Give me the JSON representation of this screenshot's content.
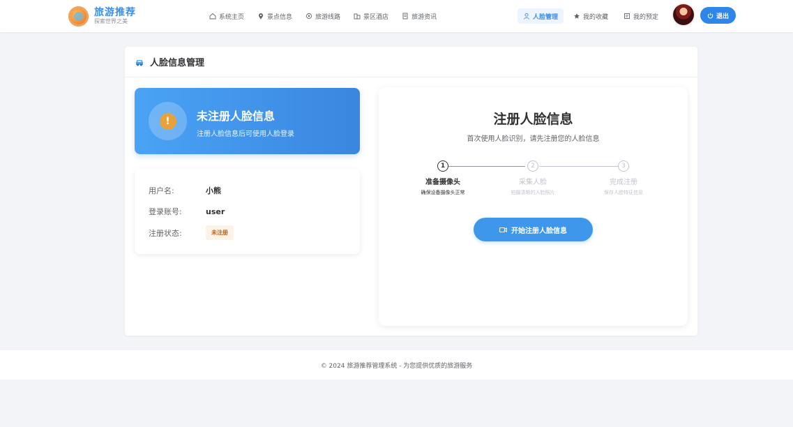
{
  "header": {
    "logo_title": "旅游推荐",
    "logo_subtitle": "探索世界之美",
    "nav": [
      {
        "label": "系统主页",
        "icon": "home-icon"
      },
      {
        "label": "景点信息",
        "icon": "location-pin-icon"
      },
      {
        "label": "旅游线路",
        "icon": "route-icon"
      },
      {
        "label": "景区酒店",
        "icon": "hotel-icon"
      },
      {
        "label": "旅游资讯",
        "icon": "document-icon"
      }
    ],
    "right_nav": [
      {
        "label": "人脸管理",
        "icon": "user-icon",
        "active": true
      },
      {
        "label": "我的收藏",
        "icon": "star-icon",
        "active": false
      },
      {
        "label": "我的预定",
        "icon": "reservation-icon",
        "active": false
      }
    ],
    "logout_label": "退出"
  },
  "page": {
    "title": "人脸信息管理",
    "title_icon": "car-icon"
  },
  "status": {
    "title": "未注册人脸信息",
    "description": "注册人脸信息后可使用人脸登录",
    "icon_text": "!"
  },
  "user_info": {
    "username_label": "用户名:",
    "username": "小熊",
    "account_label": "登录账号:",
    "account": "user",
    "reg_status_label": "注册状态:",
    "reg_status": "未注册"
  },
  "register": {
    "title": "注册人脸信息",
    "subtitle": "首次使用人脸识别，请先注册您的人脸信息",
    "steps": [
      {
        "num": "1",
        "title": "准备摄像头",
        "desc": "确保设备摄像头正常",
        "active": true
      },
      {
        "num": "2",
        "title": "采集人脸",
        "desc": "拍摄清晰的人脸照片",
        "active": false
      },
      {
        "num": "3",
        "title": "完成注册",
        "desc": "保存人脸特征信息",
        "active": false
      }
    ],
    "start_button": "开始注册人脸信息"
  },
  "footer": {
    "text": "© 2024 旅游推荐管理系统 - 为您提供优质的旅游服务"
  },
  "colors": {
    "primary": "#3a8ee6",
    "banner_start": "#4aa3f5",
    "banner_end": "#3a86e0",
    "warning": "#e6a23c"
  }
}
